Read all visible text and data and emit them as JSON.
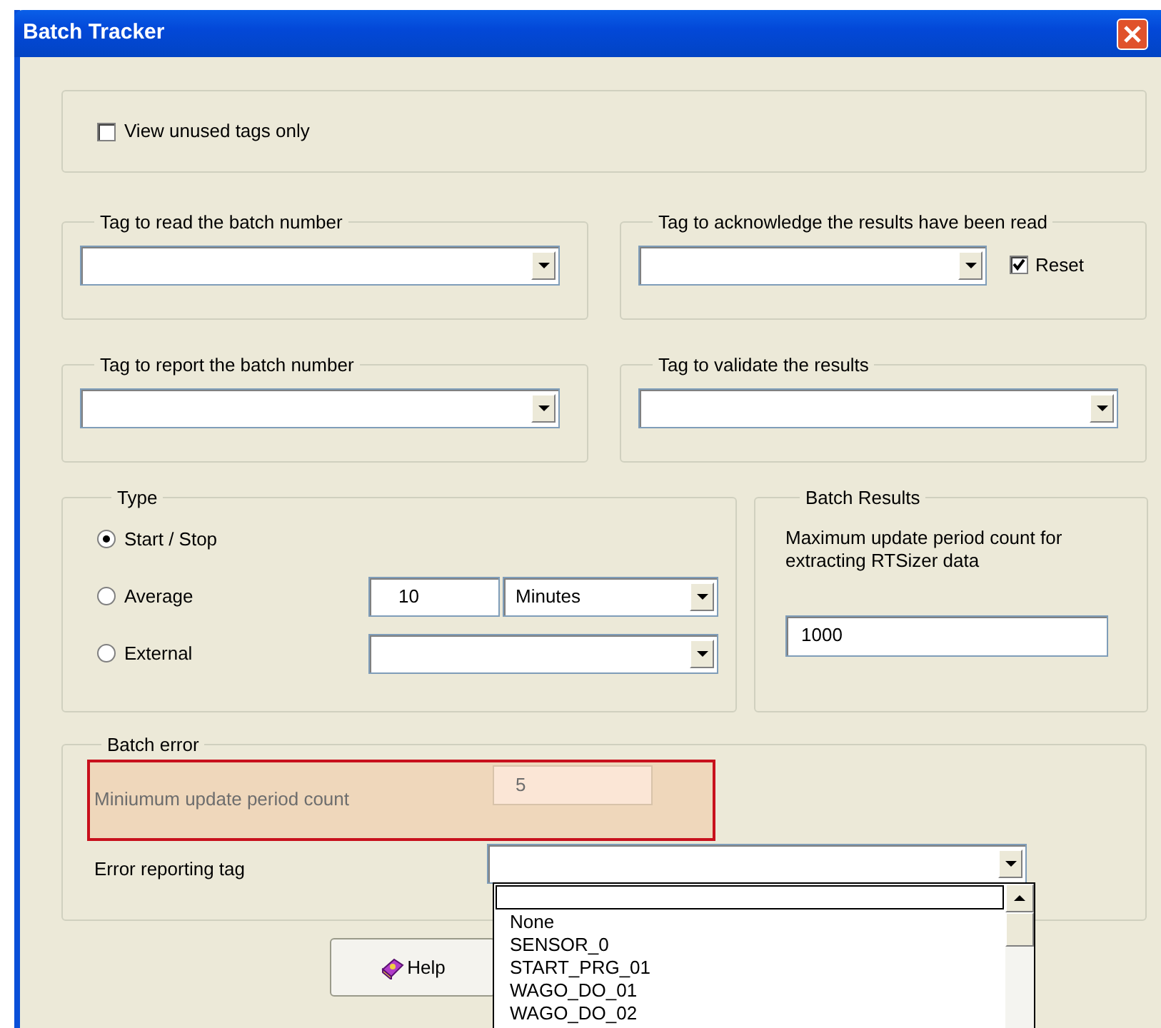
{
  "window": {
    "title": "Batch Tracker"
  },
  "view_unused": {
    "label": "View unused tags only",
    "checked": false
  },
  "read_tag": {
    "label": "Tag to read the batch number"
  },
  "acknowledge_tag": {
    "label": "Tag to acknowledge the results have been read",
    "reset": {
      "label": "Reset",
      "checked": true
    }
  },
  "report_tag": {
    "label": "Tag to report the batch number"
  },
  "validate_tag": {
    "label": "Tag to validate the results"
  },
  "type": {
    "label": "Type",
    "options": [
      {
        "label": "Start / Stop",
        "selected": true
      },
      {
        "label": "Average",
        "selected": false
      },
      {
        "label": "External",
        "selected": false
      }
    ],
    "average_value": "10",
    "average_unit": "Minutes"
  },
  "batch_results": {
    "label": "Batch Results",
    "description": "Maximum update period count for extracting RTSizer data",
    "value": "1000"
  },
  "batch_error": {
    "label": "Batch error",
    "min_count": {
      "label": "Miniumum update period count",
      "value": "5",
      "disabled": true
    },
    "error_tag": {
      "label": "Error reporting tag",
      "expanded": true,
      "items": [
        {
          "label": "None"
        },
        {
          "label": "SENSOR_0"
        },
        {
          "label": "START_PRG_01"
        },
        {
          "label": "WAGO_DO_01"
        },
        {
          "label": "WAGO_DO_02"
        }
      ]
    }
  },
  "buttons": [
    {
      "label": "Help"
    }
  ]
}
